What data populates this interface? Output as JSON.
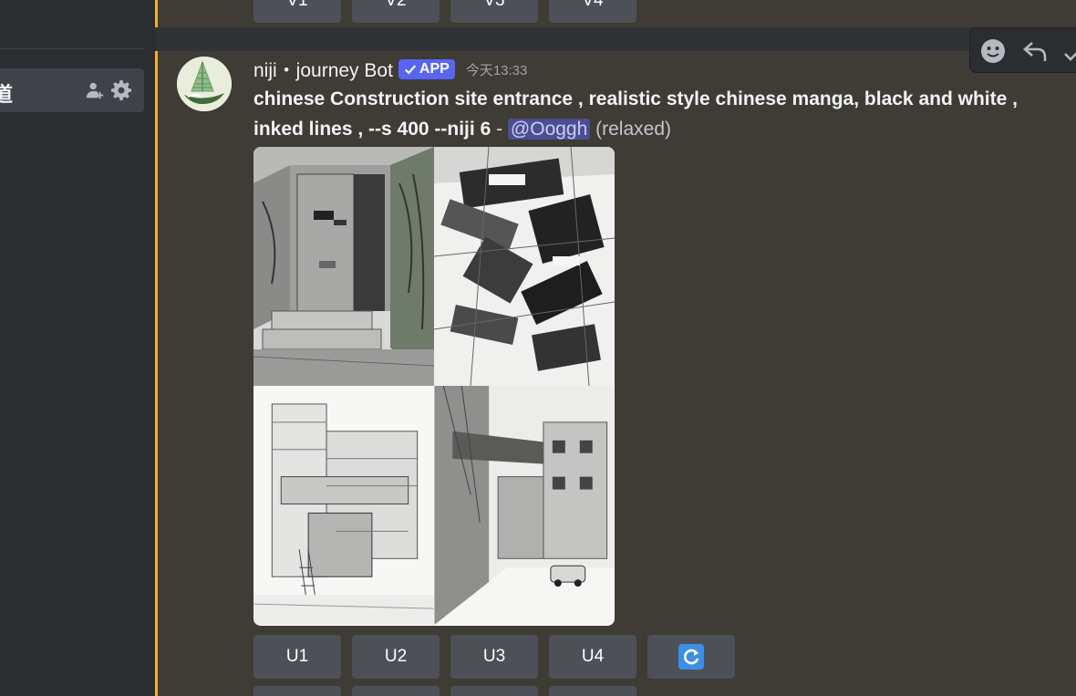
{
  "sidebar": {
    "active_channel_label": "道"
  },
  "prev_message": {
    "buttons": [
      "V1",
      "V2",
      "V3",
      "V4"
    ]
  },
  "message": {
    "author": "niji・journey Bot",
    "badge": "APP",
    "timestamp": "今天13:33",
    "prompt_line1": "chinese Construction site entrance ,   realistic style chinese manga, black and white ,",
    "prompt_line2": "inked lines , --s 400 --niji 6",
    "separator": " - ",
    "mention": "@Ooggh",
    "mode": "(relaxed)",
    "upscale_buttons": [
      "U1",
      "U2",
      "U3",
      "U4"
    ],
    "reroll_icon": "refresh-icon"
  },
  "colors": {
    "mention_bar": "#f0b232",
    "badge": "#5865f2",
    "button": "#4e5058",
    "reroll": "#3d8ee6"
  }
}
